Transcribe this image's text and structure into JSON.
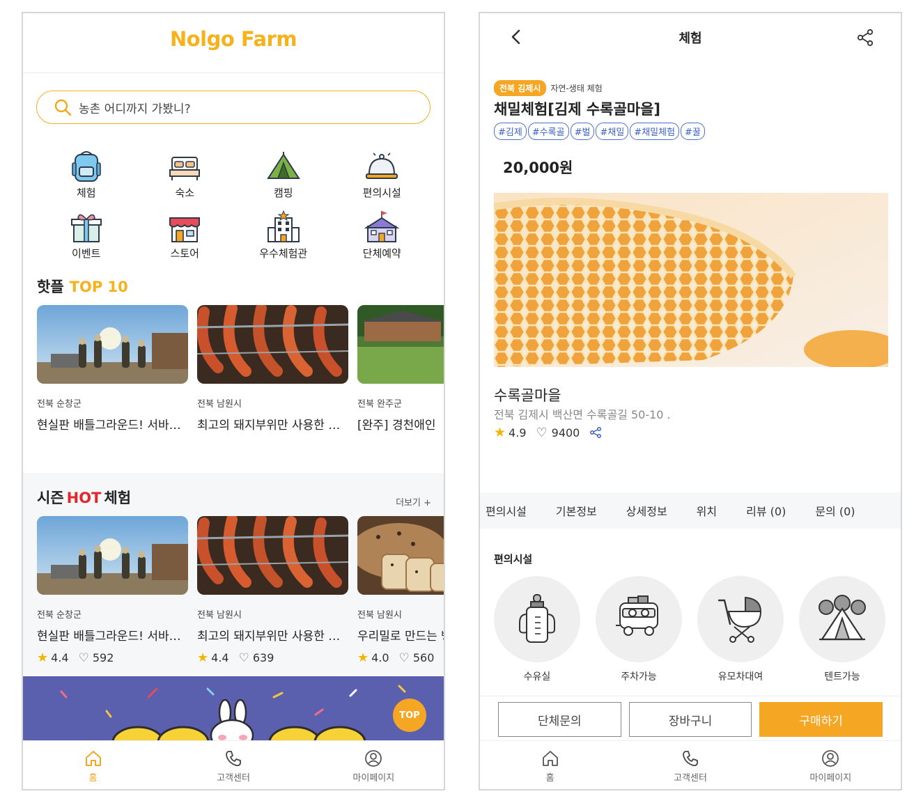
{
  "left": {
    "logo": "Nolgo Farm",
    "search": {
      "placeholder": "농촌 어디까지 가봤니?"
    },
    "categories": [
      "체험",
      "숙소",
      "캠핑",
      "편의시설",
      "이벤트",
      "스토어",
      "우수체험관",
      "단체예약"
    ],
    "hot_top": {
      "title": "핫플",
      "accent": "TOP 10"
    },
    "top_cards": [
      {
        "region": "전북 순창군",
        "title": "현실판 배틀그라운드! 서바이벌 체험"
      },
      {
        "region": "전북 남원시",
        "title": "최고의 돼지부위만 사용한 소시지 만들기"
      },
      {
        "region": "전북 완주군",
        "title": "[완주] 경천애인"
      }
    ],
    "season": {
      "title_pre": "시즌",
      "title_hot": "HOT",
      "title_post": "체험",
      "more": "더보기 +"
    },
    "season_cards": [
      {
        "region": "전북 순창군",
        "title": "현실판 배틀그라운드! 서바이벌 체험",
        "rating": "4.4",
        "likes": "592"
      },
      {
        "region": "전북 남원시",
        "title": "최고의 돼지부위만 사용한 소시지 만들기",
        "rating": "4.4",
        "likes": "639"
      },
      {
        "region": "전북 남원시",
        "title": "우리밀로 만드는 빵",
        "rating": "4.0",
        "likes": "560"
      }
    ],
    "top_button": "TOP",
    "nav": [
      "홈",
      "고객센터",
      "마이페이지"
    ]
  },
  "right": {
    "header_title": "체험",
    "region_badge": "전북 김제시",
    "category": "자연-생태 체험",
    "title": "채밀체험[김제 수록골마을]",
    "tags": [
      "#김제",
      "#수록골",
      "#벌",
      "#채밀",
      "#채밀체험",
      "#꿀"
    ],
    "price": "20,000원",
    "place_name": "수록골마을",
    "address": "전북 김제시 백산면 수록골길 50-10 .",
    "rating": "4.9",
    "likes": "9400",
    "tabs": [
      "편의시설",
      "기본정보",
      "상세정보",
      "위치",
      "리뷰 (0)",
      "문의 (0)"
    ],
    "facilities_title": "편의시설",
    "facilities": [
      "수유실",
      "주차가능",
      "유모차대여",
      "텐트가능"
    ],
    "actions": {
      "group": "단체문의",
      "cart": "장바구니",
      "buy": "구매하기"
    },
    "nav": [
      "홈",
      "고객센터",
      "마이페이지"
    ]
  },
  "colors": {
    "accent": "#f5a623",
    "hot_red": "#e3262b",
    "tag_blue": "#3c60c4",
    "banner": "#5b60ae"
  },
  "icons": [
    "search-icon",
    "backpack-icon",
    "bed-icon",
    "tent-icon",
    "service-bell-icon",
    "gift-icon",
    "store-icon",
    "building-icon",
    "school-icon",
    "home-icon",
    "phone-icon",
    "user-icon",
    "back-icon",
    "share-icon",
    "star-icon",
    "heart-icon",
    "baby-bottle-icon",
    "van-icon",
    "stroller-icon",
    "camping-tent-icon"
  ]
}
